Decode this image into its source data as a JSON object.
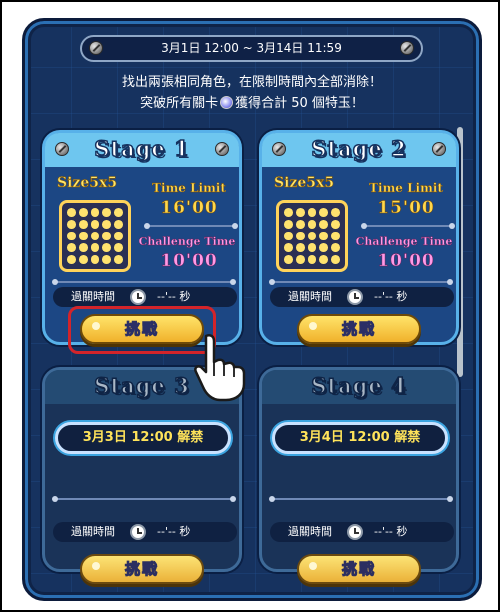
{
  "event": {
    "period": "3月1日 12:00 ~ 3月14日 11:59",
    "description_line1": "找出兩張相同角色，在限制時間內全部消除！",
    "description_line2_prefix": "突破所有關卡",
    "description_line2_suffix": "獲得合計 50 個特玉！",
    "gem_icon": "gem-icon"
  },
  "labels": {
    "size": "Size5x5",
    "time_limit": "Time Limit",
    "challenge_time": "Challenge Time",
    "clear_time": "過關時間",
    "clear_time_value": "--'-- 秒",
    "challenge_button": "挑戰"
  },
  "stages": [
    {
      "title": "Stage 1",
      "time_limit": "16'00",
      "challenge_time": "10'00",
      "locked": false
    },
    {
      "title": "Stage 2",
      "time_limit": "15'00",
      "challenge_time": "10'00",
      "locked": false
    },
    {
      "title": "Stage 3",
      "unlock_text": "3月3日 12:00 解禁",
      "locked": true
    },
    {
      "title": "Stage 4",
      "unlock_text": "3月4日 12:00 解禁",
      "locked": true
    }
  ],
  "colors": {
    "panel_bg": "#16325f",
    "active_header": "#6ec6ef",
    "button_yellow": "#ffe46a",
    "time_limit_text": "#ffd84c",
    "challenge_time_text": "#ff9ae6",
    "highlight_red": "#d3242a"
  }
}
